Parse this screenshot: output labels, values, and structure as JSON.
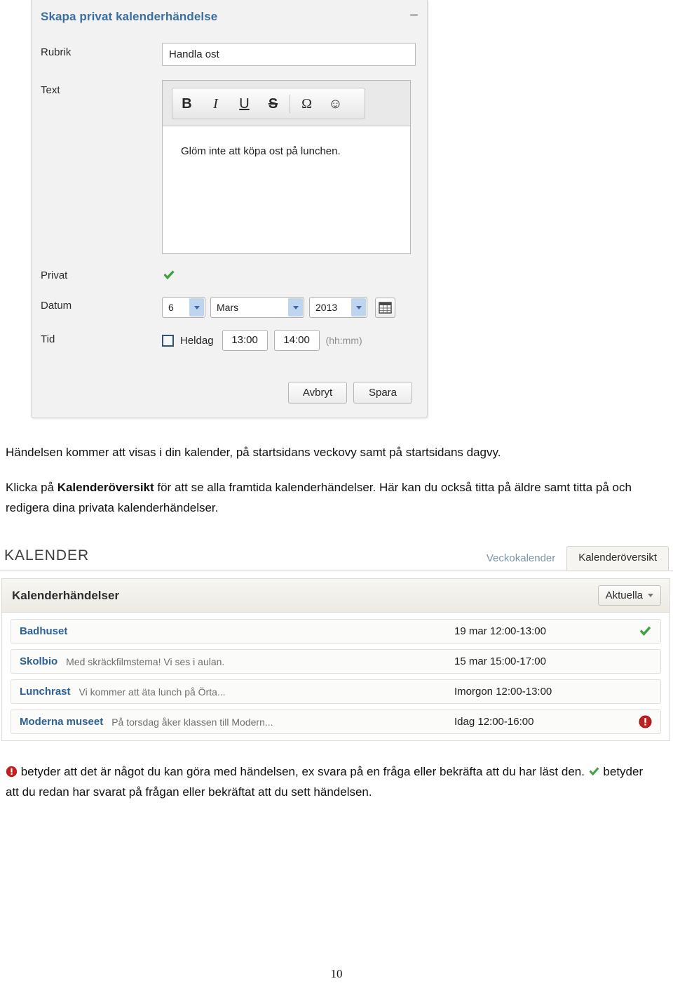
{
  "dialog": {
    "title": "Skapa privat kalenderhändelse",
    "minimize_icon": "minimize-icon",
    "labels": {
      "rubrik": "Rubrik",
      "text": "Text",
      "privat": "Privat",
      "datum": "Datum",
      "tid": "Tid"
    },
    "rubrik_value": "Handla ost",
    "rubrik_placeholder": "",
    "editor": {
      "toolbar": [
        {
          "name": "bold-icon",
          "glyph": "B"
        },
        {
          "name": "italic-icon",
          "glyph": "I"
        },
        {
          "name": "underline-icon",
          "glyph": "U"
        },
        {
          "name": "strikethrough-icon",
          "glyph": "S"
        },
        {
          "name": "special-character-icon",
          "glyph": "Ω"
        },
        {
          "name": "emoticon-icon",
          "glyph": "☺"
        }
      ],
      "body_text": "Glöm inte att köpa ost på lunchen."
    },
    "privat_checked": true,
    "privat_icon": "green-check-icon",
    "date": {
      "day": "6",
      "month": "Mars",
      "year": "2013",
      "picker_icon": "calendar-icon"
    },
    "time": {
      "heldag_checked": false,
      "heldag_label": "Heldag",
      "start": "13:00",
      "end": "14:00",
      "format_hint": "(hh:mm)"
    },
    "buttons": {
      "cancel": "Avbryt",
      "save": "Spara"
    }
  },
  "document": {
    "paragraph_1": "Händelsen kommer att visas i din kalender, på startsidans veckovy samt på startsidans dagvy.",
    "paragraph_2_pre": "Klicka på ",
    "paragraph_2_bold": "Kalenderöversikt",
    "paragraph_2_post": " för att se alla framtida kalenderhändelser. Här kan du också titta på äldre samt titta på och redigera dina privata kalenderhändelser.",
    "legend_alert_text": " betyder att det är något du kan göra med händelsen, ex svara på en fråga eller bekräfta att du har läst den. ",
    "legend_check_text": " betyder att du redan har svarat på frågan eller bekräftat att du sett händelsen.",
    "page_number": "10"
  },
  "calendar": {
    "heading": "KALENDER",
    "tabs": [
      {
        "label": "Veckokalender",
        "active": false
      },
      {
        "label": "Kalenderöversikt",
        "active": true
      }
    ],
    "panel_title": "Kalenderhändelser",
    "filter_button": "Aktuella",
    "filter_caret_icon": "chevron-down-icon",
    "events": [
      {
        "title": "Badhuset",
        "description": "",
        "time": "19 mar 12:00-13:00",
        "status": "check",
        "status_icon": "green-check-icon"
      },
      {
        "title": "Skolbio",
        "description": "Med skräckfilmstema! Vi ses i aulan.",
        "time": "15 mar 15:00-17:00",
        "status": "none",
        "status_icon": ""
      },
      {
        "title": "Lunchrast",
        "description": "Vi kommer att äta lunch på Örta...",
        "time": "Imorgon 12:00-13:00",
        "status": "none",
        "status_icon": ""
      },
      {
        "title": "Moderna museet",
        "description": "På torsdag åker klassen till Modern...",
        "time": "Idag 12:00-16:00",
        "status": "alert",
        "status_icon": "red-alert-icon"
      }
    ]
  },
  "colors": {
    "dialog_title": "#3c6ea0",
    "event_title": "#2d6196",
    "check_green": "#3fa23f",
    "alert_red": "#c11f1f",
    "dropdown_arrow_bg": "#bfd4ef"
  }
}
